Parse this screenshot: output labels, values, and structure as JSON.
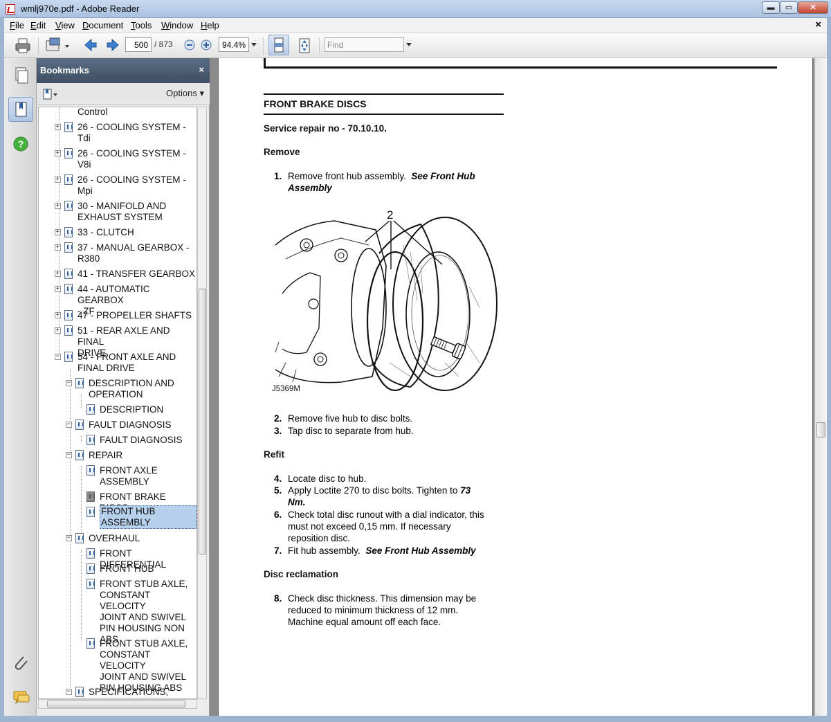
{
  "window": {
    "title": "wmlj970e.pdf - Adobe Reader",
    "min_glyph": "▬",
    "max_glyph": "▭",
    "close_glyph": "✕"
  },
  "menu": {
    "items": [
      {
        "accel": "F",
        "rest": "ile"
      },
      {
        "accel": "E",
        "rest": "dit"
      },
      {
        "accel": "V",
        "rest": "iew"
      },
      {
        "accel": "D",
        "rest": "ocument"
      },
      {
        "accel": "T",
        "rest": "ools"
      },
      {
        "accel": "W",
        "rest": "indow"
      },
      {
        "accel": "H",
        "rest": "elp"
      }
    ],
    "doc_close": "×"
  },
  "toolbar": {
    "page_current": "500",
    "page_total": "/ 873",
    "zoom": "94.4%",
    "find_placeholder": "Find"
  },
  "bookmarks": {
    "title": "Bookmarks",
    "close": "×",
    "options": "Options ▾",
    "items": [
      {
        "toggle": "",
        "lines": [
          "Control"
        ]
      },
      {
        "toggle": "+",
        "lines": [
          "26 - COOLING SYSTEM -",
          "Tdi"
        ]
      },
      {
        "toggle": "+",
        "lines": [
          "26 - COOLING SYSTEM -",
          "V8i"
        ]
      },
      {
        "toggle": "+",
        "lines": [
          "26 - COOLING SYSTEM -",
          "Mpi"
        ]
      },
      {
        "toggle": "+",
        "lines": [
          "30 - MANIFOLD AND",
          "EXHAUST SYSTEM"
        ]
      },
      {
        "toggle": "+",
        "lines": [
          "33 - CLUTCH"
        ]
      },
      {
        "toggle": "+",
        "lines": [
          "37 - MANUAL GEARBOX -",
          "R380"
        ]
      },
      {
        "toggle": "+",
        "lines": [
          "41 - TRANSFER GEARBOX"
        ]
      },
      {
        "toggle": "+",
        "lines": [
          "44 - AUTOMATIC GEARBOX",
          "- ZF"
        ]
      },
      {
        "toggle": "+",
        "lines": [
          "47 - PROPELLER SHAFTS"
        ]
      },
      {
        "toggle": "+",
        "lines": [
          "51 - REAR AXLE AND FINAL",
          "DRIVE"
        ]
      },
      {
        "toggle": "−",
        "lines": [
          "54 - FRONT AXLE AND",
          "FINAL DRIVE"
        ]
      },
      {
        "toggle": "−",
        "lines": [
          "DESCRIPTION AND",
          "OPERATION"
        ]
      },
      {
        "toggle": "",
        "lines": [
          "DESCRIPTION"
        ]
      },
      {
        "toggle": "−",
        "lines": [
          "FAULT DIAGNOSIS"
        ]
      },
      {
        "toggle": "",
        "lines": [
          "FAULT DIAGNOSIS"
        ]
      },
      {
        "toggle": "−",
        "lines": [
          "REPAIR"
        ]
      },
      {
        "toggle": "",
        "lines": [
          "FRONT AXLE",
          "ASSEMBLY"
        ]
      },
      {
        "toggle": "",
        "lines": [
          "FRONT BRAKE DISCS"
        ]
      },
      {
        "toggle": "",
        "lines": [
          "FRONT HUB",
          "ASSEMBLY"
        ]
      },
      {
        "toggle": "−",
        "lines": [
          "OVERHAUL"
        ]
      },
      {
        "toggle": "",
        "lines": [
          "FRONT DIFFERENTIAL"
        ]
      },
      {
        "toggle": "",
        "lines": [
          "FRONT HUB"
        ]
      },
      {
        "toggle": "",
        "lines": [
          "FRONT STUB AXLE,",
          "CONSTANT VELOCITY",
          "JOINT AND SWIVEL",
          "PIN HOUSING NON",
          "ABS"
        ]
      },
      {
        "toggle": "",
        "lines": [
          "FRONT STUB AXLE,",
          "CONSTANT VELOCITY",
          "JOINT AND SWIVEL",
          "PIN HOUSING ABS"
        ]
      },
      {
        "toggle": "−",
        "lines": [
          "SPECIFICATIONS,"
        ]
      }
    ]
  },
  "document": {
    "heading": "FRONT BRAKE DISCS",
    "service_repair": "Service repair no - 70.10.10.",
    "remove_heading": "Remove",
    "refit_heading": "Refit",
    "reclamation_heading": "Disc reclamation",
    "figure_caption": "J5369M",
    "figure_label": "2",
    "steps": {
      "s1": {
        "num": "1.",
        "text": "Remove front hub assembly.",
        "ref": "See  Front Hub",
        "ref2": "Assembly"
      },
      "s2": {
        "num": "2.",
        "text": "Remove five hub to disc bolts."
      },
      "s3": {
        "num": "3.",
        "text": "Tap disc to separate from hub."
      },
      "s4": {
        "num": "4.",
        "text": "Locate disc to hub."
      },
      "s5": {
        "num": "5.",
        "text": "Apply Loctite 270 to disc bolts.  Tighten to",
        "value": "73",
        "unit": "Nm."
      },
      "s6": {
        "num": "6.",
        "lines": [
          "Check total disc runout with a dial indicator, this",
          "must not exceed 0,15 mm. If necessary",
          "reposition disc."
        ]
      },
      "s7": {
        "num": "7.",
        "text": "Fit hub assembly.",
        "ref": "See  Front Hub Assembly"
      },
      "s8": {
        "num": "8.",
        "lines": [
          "Check disc thickness. This dimension may be",
          "reduced to minimum thickness of 12 mm.",
          "Machine equal amount off each face."
        ]
      }
    }
  }
}
